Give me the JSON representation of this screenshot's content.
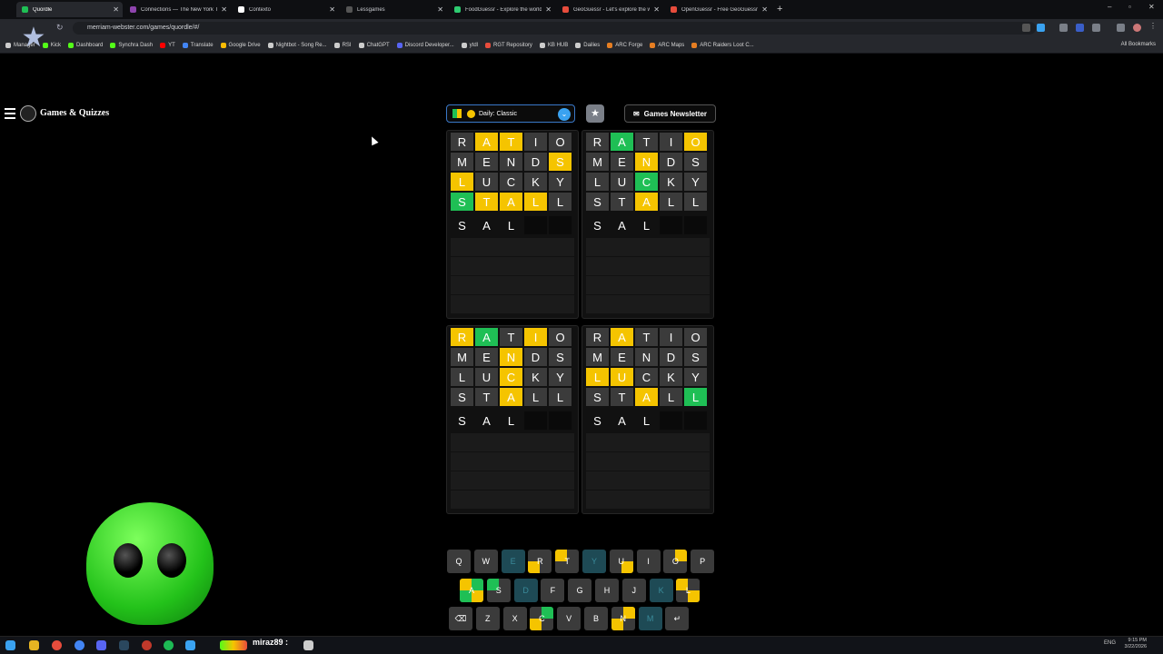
{
  "browser": {
    "tabs": [
      {
        "title": "Quordle",
        "active": true,
        "color": "#1fbf55"
      },
      {
        "title": "Connections — The New York T",
        "active": false,
        "color": "#8e44ad"
      },
      {
        "title": "Contexto",
        "active": false,
        "color": "#ffffff"
      },
      {
        "title": "Lessgames",
        "active": false,
        "color": "#555555"
      },
      {
        "title": "FoodGuessr - Explore the world",
        "active": false,
        "color": "#2ecc71"
      },
      {
        "title": "GeoGuessr - Let's explore the w",
        "active": false,
        "color": "#e74c3c"
      },
      {
        "title": "OpenGuessr - Free GeoGuessr",
        "active": false,
        "color": "#e74c3c"
      }
    ],
    "url": "merriam-webster.com/games/quordle/#/",
    "bookmarks": [
      {
        "label": "Manager",
        "color": "#cccccc"
      },
      {
        "label": "Kick",
        "color": "#53fc18"
      },
      {
        "label": "Dashboard",
        "color": "#53fc18"
      },
      {
        "label": "Synchra Dash",
        "color": "#53fc18"
      },
      {
        "label": "YT",
        "color": "#ff0000"
      },
      {
        "label": "Translate",
        "color": "#4285f4"
      },
      {
        "label": "Google Drive",
        "color": "#fbbc04"
      },
      {
        "label": "Nightbot - Song Re...",
        "color": "#cccccc"
      },
      {
        "label": "RSI",
        "color": "#cccccc"
      },
      {
        "label": "ChatGPT",
        "color": "#cccccc"
      },
      {
        "label": "Discord Developer...",
        "color": "#5865f2"
      },
      {
        "label": "ytdl",
        "color": "#cccccc"
      },
      {
        "label": "RGT Repository",
        "color": "#e74c3c"
      },
      {
        "label": "KB HUB",
        "color": "#cccccc"
      },
      {
        "label": "Dailies",
        "color": "#cccccc"
      },
      {
        "label": "ARC Forge",
        "color": "#e67e22"
      },
      {
        "label": "ARC Maps",
        "color": "#e67e22"
      },
      {
        "label": "ARC Raiders Loot C...",
        "color": "#e67e22"
      }
    ],
    "all_bookmarks": "All Bookmarks"
  },
  "site": {
    "brand": "Games & Quizzes",
    "mode_label": "Daily: Classic",
    "newsletter_label": "Games Newsletter"
  },
  "boards": [
    {
      "guesses": [
        {
          "letters": [
            "R",
            "A",
            "T",
            "I",
            "O"
          ],
          "states": [
            "x",
            "y",
            "y",
            "x",
            "x"
          ]
        },
        {
          "letters": [
            "M",
            "E",
            "N",
            "D",
            "S"
          ],
          "states": [
            "x",
            "x",
            "x",
            "x",
            "y"
          ]
        },
        {
          "letters": [
            "L",
            "U",
            "C",
            "K",
            "Y"
          ],
          "states": [
            "y",
            "x",
            "x",
            "x",
            "x"
          ]
        },
        {
          "letters": [
            "S",
            "T",
            "A",
            "L",
            "L"
          ],
          "states": [
            "g",
            "y",
            "y",
            "y",
            "x"
          ]
        }
      ],
      "current": [
        "S",
        "A",
        "L",
        "",
        ""
      ]
    },
    {
      "guesses": [
        {
          "letters": [
            "R",
            "A",
            "T",
            "I",
            "O"
          ],
          "states": [
            "x",
            "g",
            "x",
            "x",
            "y"
          ]
        },
        {
          "letters": [
            "M",
            "E",
            "N",
            "D",
            "S"
          ],
          "states": [
            "x",
            "x",
            "y",
            "x",
            "x"
          ]
        },
        {
          "letters": [
            "L",
            "U",
            "C",
            "K",
            "Y"
          ],
          "states": [
            "x",
            "x",
            "g",
            "x",
            "x"
          ]
        },
        {
          "letters": [
            "S",
            "T",
            "A",
            "L",
            "L"
          ],
          "states": [
            "x",
            "x",
            "y",
            "x",
            "x"
          ]
        }
      ],
      "current": [
        "S",
        "A",
        "L",
        "",
        ""
      ]
    },
    {
      "guesses": [
        {
          "letters": [
            "R",
            "A",
            "T",
            "I",
            "O"
          ],
          "states": [
            "y",
            "g",
            "x",
            "y",
            "x"
          ]
        },
        {
          "letters": [
            "M",
            "E",
            "N",
            "D",
            "S"
          ],
          "states": [
            "x",
            "x",
            "y",
            "x",
            "x"
          ]
        },
        {
          "letters": [
            "L",
            "U",
            "C",
            "K",
            "Y"
          ],
          "states": [
            "x",
            "x",
            "y",
            "x",
            "x"
          ]
        },
        {
          "letters": [
            "S",
            "T",
            "A",
            "L",
            "L"
          ],
          "states": [
            "x",
            "x",
            "y",
            "x",
            "x"
          ]
        }
      ],
      "current": [
        "S",
        "A",
        "L",
        "",
        ""
      ]
    },
    {
      "guesses": [
        {
          "letters": [
            "R",
            "A",
            "T",
            "I",
            "O"
          ],
          "states": [
            "x",
            "y",
            "x",
            "x",
            "x"
          ]
        },
        {
          "letters": [
            "M",
            "E",
            "N",
            "D",
            "S"
          ],
          "states": [
            "x",
            "x",
            "x",
            "x",
            "x"
          ]
        },
        {
          "letters": [
            "L",
            "U",
            "C",
            "K",
            "Y"
          ],
          "states": [
            "y",
            "y",
            "x",
            "x",
            "x"
          ]
        },
        {
          "letters": [
            "S",
            "T",
            "A",
            "L",
            "L"
          ],
          "states": [
            "x",
            "x",
            "y",
            "x",
            "g"
          ]
        }
      ],
      "current": [
        "S",
        "A",
        "L",
        "",
        ""
      ]
    }
  ],
  "keyboard": {
    "row1": [
      "Q",
      "W",
      "E",
      "R",
      "T",
      "Y",
      "U",
      "I",
      "O",
      "P"
    ],
    "row2": [
      "A",
      "S",
      "D",
      "F",
      "G",
      "H",
      "J",
      "K",
      "L"
    ],
    "row3": [
      "⌫",
      "Z",
      "X",
      "C",
      "V",
      "B",
      "N",
      "M",
      "↵"
    ]
  },
  "stream": {
    "username": "miraz89 :"
  },
  "system": {
    "lang": "ENG",
    "time": "9:15 PM",
    "date": "3/22/2026"
  },
  "colors": {
    "correct": "#1fbf55",
    "present": "#f5c400",
    "absent": "#3b3b3b"
  }
}
